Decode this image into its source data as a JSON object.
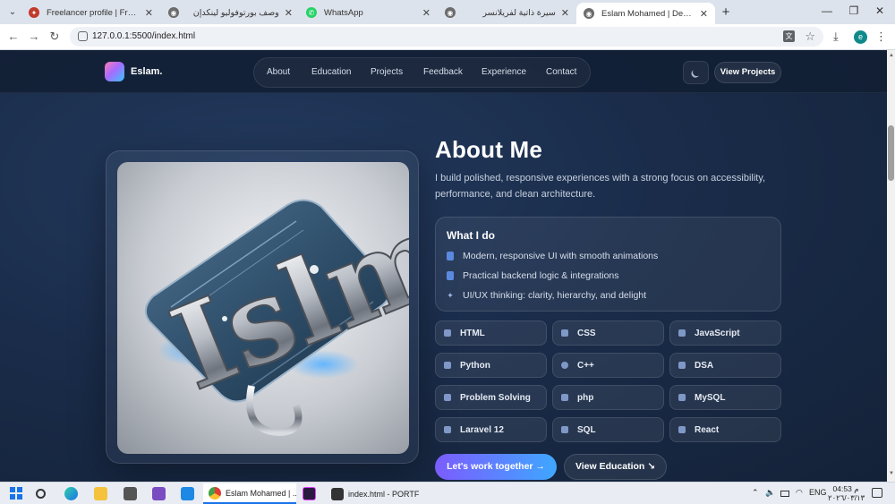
{
  "browser": {
    "tabs": [
      {
        "label": "Freelancer profile | Freelance Yo",
        "favicon_color": "#c0392b",
        "favicon": "✦"
      },
      {
        "label": "وصف بورتوفوليو لينكدإن",
        "favicon_color": "#6b6b6b",
        "favicon": "◉"
      },
      {
        "label": "WhatsApp",
        "favicon_color": "#25d366",
        "favicon": "✆"
      },
      {
        "label": "سيرة ذاتية لفريلانسر",
        "favicon_color": "#6b6b6b",
        "favicon": "◉"
      },
      {
        "label": "Eslam Mohamed | Developer Po",
        "favicon_color": "#6b6b6b",
        "favicon": "◉"
      }
    ],
    "active_tab_index": 4,
    "url": "127.0.0.1:5500/index.html",
    "profile_initial": "e"
  },
  "site": {
    "logo": "Eslam.",
    "nav": [
      "About",
      "Education",
      "Projects",
      "Feedback",
      "Experience",
      "Contact"
    ],
    "header_button": "View Projects"
  },
  "about": {
    "title": "About Me",
    "description": "I build polished, responsive experiences with a strong focus on accessibility, performance, and clean architecture.",
    "whatido_title": "What I do",
    "whatido_items": [
      "Modern, responsive UI with smooth animations",
      "Practical backend logic & integrations",
      "UI/UX thinking: clarity, hierarchy, and delight"
    ],
    "skills": [
      "HTML",
      "CSS",
      "JavaScript",
      "Python",
      "C++",
      "DSA",
      "Problem Solving",
      "php",
      "MySQL",
      "Laravel 12",
      "SQL",
      "React"
    ],
    "cta_primary": "Let's work together  →",
    "cta_secondary": "View Education  ↘"
  },
  "image": {
    "logo_text": "Islm"
  },
  "taskbar": {
    "apps": [
      {
        "label": "Eslam Mohamed | ...",
        "color": "#e53935"
      },
      {
        "label": "index.html - PORTF...",
        "color": "#333333"
      }
    ],
    "language": "ENG",
    "time": "04:53 م",
    "date": "٢٠٢٦/٠٣/١٣"
  }
}
